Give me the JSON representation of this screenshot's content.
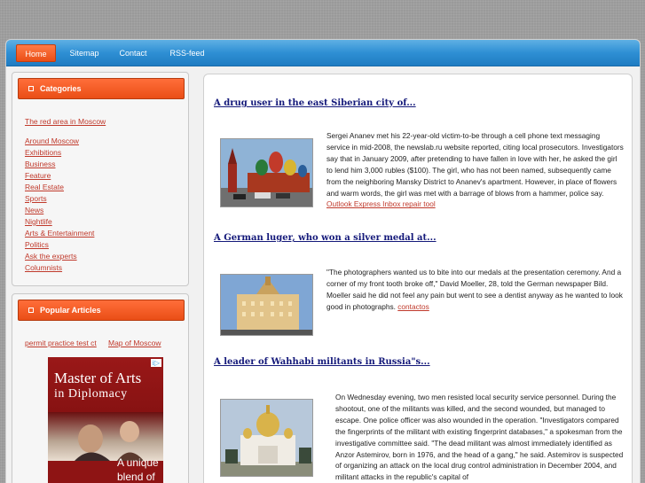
{
  "nav": {
    "items": [
      {
        "label": "Home",
        "active": true
      },
      {
        "label": "Sitemap",
        "active": false
      },
      {
        "label": "Contact",
        "active": false
      },
      {
        "label": "RSS-feed",
        "active": false
      }
    ]
  },
  "sidebar": {
    "categories": {
      "title": "Categories",
      "featured_link": "The red area in Moscow",
      "links": [
        "Around Moscow",
        "Exhibitions",
        "Business",
        "Feature",
        "Real Estate",
        "Sports",
        "News",
        "Nightlife",
        "Arts & Entertainment",
        "Politics",
        "Ask the experts",
        "Columnists"
      ]
    },
    "popular": {
      "title": "Popular Articles",
      "links": [
        "permit practice test ct",
        "Map of Moscow"
      ]
    }
  },
  "ad": {
    "line1": "Master of Arts",
    "line2": "in Diplomacy",
    "line3": "A unique",
    "line4": "blend of",
    "badge": "i▷"
  },
  "articles": [
    {
      "title": "A drug user in the east Siberian city of...",
      "text": "Sergei Ananev met his 22-year-old victim-to-be through a cell phone text messaging service in mid-2008, the newslab.ru website reported, citing local prosecutors. Investigators say that in January 2009, after pretending to have fallen in love with her, he asked the girl to lend him 3,000 rubles ($100). The girl, who has not been named, subsequently came from the neighboring Mansky District to Ananev's apartment. However, in place of flowers and warm words, the girl was met with a barrage of blows from a hammer, police say.",
      "link": "Outlook Express Inbox repair tool"
    },
    {
      "title": "A German luger, who won a silver medal at...",
      "text": "\"The photographers wanted us to bite into our medals at the presentation ceremony. And a corner of my front tooth broke off,\" David Moeller, 28, told the German newspaper Bild. Moeller said he did not feel any pain but went to see a dentist anyway as he wanted to look good in photographs.",
      "link": "contactos"
    },
    {
      "title": "A leader of Wahhabi militants in Russia\"s...",
      "text": "On Wednesday evening, two men resisted local security service personnel. During the shootout, one of the militants was killed, and the second wounded, but managed to escape. One police officer was also wounded in the operation. \"Investigators compared the fingerprints of the militant with existing fingerprint databases,\" a spokesman from the investigative committee said. \"The dead militant was almost immediately identified as Anzor Astemirov, born in 1976, and the head of a gang,\" he said. Astemirov is suspected of organizing an attack on the local drug control administration in December 2004, and militant attacks in the republic's capital of",
      "link": ""
    }
  ],
  "colors": {
    "nav_blue": "#2e8fd4",
    "accent_orange": "#ea4e16",
    "link_red": "#c0392b",
    "title_navy": "#14197a"
  }
}
